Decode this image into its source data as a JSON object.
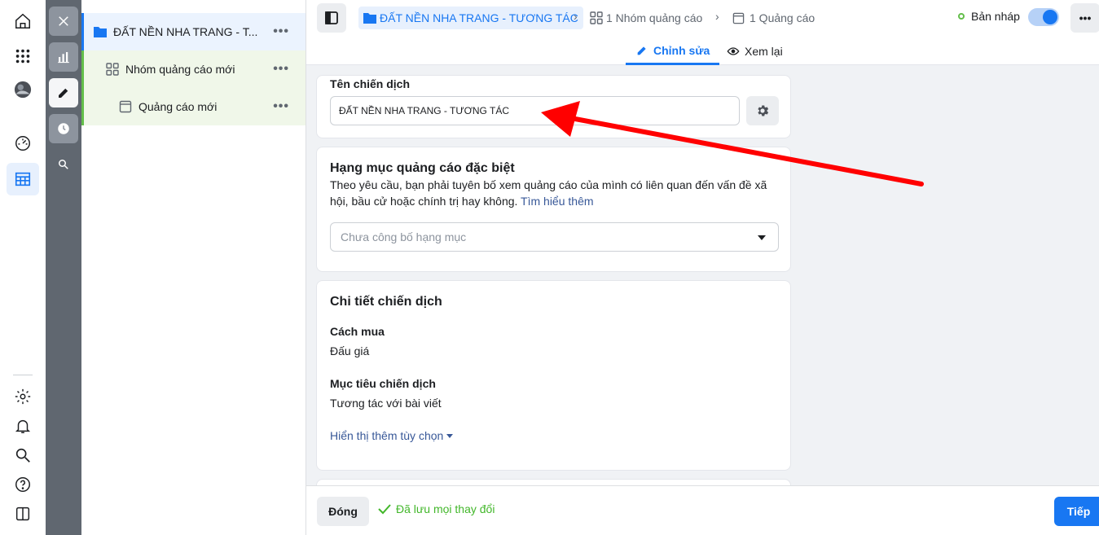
{
  "tree": {
    "campaign": {
      "label": "ĐẤT NỀN NHA TRANG - T...",
      "more": "•••"
    },
    "adset": {
      "label": "Nhóm quảng cáo mới",
      "more": "•••"
    },
    "ad": {
      "label": "Quảng cáo mới",
      "more": "•••"
    }
  },
  "header": {
    "breadcrumb_campaign": "ĐẤT NỀN NHA TRANG - TƯƠNG TÁC",
    "breadcrumb_adsets": "1 Nhóm quảng cáo",
    "breadcrumb_ads": "1 Quảng cáo",
    "draft_label": "Bản nháp",
    "more": "•••",
    "tab_edit": "Chỉnh sửa",
    "tab_review": "Xem lại"
  },
  "campaign_name": {
    "label": "Tên chiến dịch",
    "value": "ĐẤT NỀN NHA TRANG - TƯƠNG TÁC"
  },
  "special_category": {
    "title": "Hạng mục quảng cáo đặc biệt",
    "description": "Theo yêu cầu, bạn phải tuyên bố xem quảng cáo của mình có liên quan đến vấn đề xã hội, bầu cử hoặc chính trị hay không.",
    "learn_more": "Tìm hiểu thêm",
    "select_placeholder": "Chưa công bố hạng mục"
  },
  "details": {
    "title": "Chi tiết chiến dịch",
    "buying_label": "Cách mua",
    "buying_value": "Đấu giá",
    "objective_label": "Mục tiêu chiến dịch",
    "objective_value": "Tương tác với bài viết",
    "more_options": "Hiển thị thêm tùy chọn"
  },
  "footer": {
    "close": "Đóng",
    "saved": "Đã lưu mọi thay đổi",
    "next": "Tiếp"
  },
  "colors": {
    "accent": "#1877f2",
    "draft_green": "#63be4a",
    "saved_green": "#42b72a",
    "annotation_arrow": "#ff0000"
  }
}
